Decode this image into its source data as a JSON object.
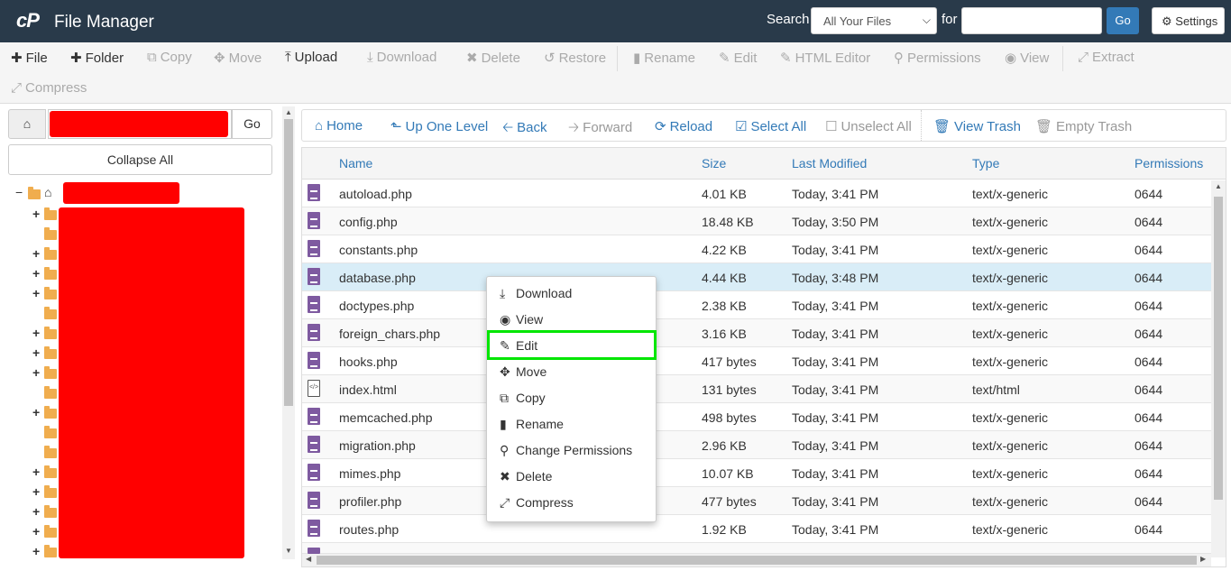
{
  "header": {
    "logo": "cP",
    "title": "File Manager",
    "search_label": "Search",
    "search_scope": "All Your Files",
    "for_label": "for",
    "search_value": "",
    "go_label": "Go",
    "settings_label": "Settings"
  },
  "toolbar": {
    "items": [
      {
        "label": "File",
        "icon": "plus-icon",
        "enabled": true
      },
      {
        "label": "Folder",
        "icon": "plus-icon",
        "enabled": true
      },
      {
        "label": "Copy",
        "icon": "copy-icon",
        "enabled": false
      },
      {
        "label": "Move",
        "icon": "move-icon",
        "enabled": false
      },
      {
        "label": "Upload",
        "icon": "upload-icon",
        "enabled": true
      },
      {
        "label": "Download",
        "icon": "download-icon",
        "enabled": false
      },
      {
        "label": "Delete",
        "icon": "delete-icon",
        "enabled": false
      },
      {
        "label": "Restore",
        "icon": "restore-icon",
        "enabled": false
      },
      {
        "label": "Rename",
        "icon": "file-icon",
        "enabled": false
      },
      {
        "label": "Edit",
        "icon": "pencil-icon",
        "enabled": false
      },
      {
        "label": "HTML Editor",
        "icon": "edit-square-icon",
        "enabled": false
      },
      {
        "label": "Permissions",
        "icon": "key-icon",
        "enabled": false
      },
      {
        "label": "View",
        "icon": "eye-icon",
        "enabled": false
      },
      {
        "label": "Extract",
        "icon": "extract-icon",
        "enabled": false
      },
      {
        "label": "Compress",
        "icon": "compress-icon",
        "enabled": false
      }
    ]
  },
  "left": {
    "go_label": "Go",
    "collapse_label": "Collapse All"
  },
  "nav": {
    "items": [
      {
        "label": "Home",
        "icon": "home-icon",
        "enabled": true
      },
      {
        "label": "Up One Level",
        "icon": "level-up-icon",
        "enabled": true
      },
      {
        "label": "Back",
        "icon": "arrow-left-icon",
        "enabled": true
      },
      {
        "label": "Forward",
        "icon": "arrow-right-icon",
        "enabled": false
      },
      {
        "label": "Reload",
        "icon": "reload-icon",
        "enabled": true
      },
      {
        "label": "Select All",
        "icon": "checkbox-checked-icon",
        "enabled": true
      },
      {
        "label": "Unselect All",
        "icon": "checkbox-empty-icon",
        "enabled": false
      },
      {
        "label": "View Trash",
        "icon": "trash-icon",
        "enabled": true
      },
      {
        "label": "Empty Trash",
        "icon": "trash-icon",
        "enabled": false
      }
    ]
  },
  "table": {
    "columns": [
      "Name",
      "Size",
      "Last Modified",
      "Type",
      "Permissions"
    ],
    "rows": [
      {
        "name": "autoload.php",
        "size": "4.01 KB",
        "modified": "Today, 3:41 PM",
        "type": "text/x-generic",
        "perms": "0644"
      },
      {
        "name": "config.php",
        "size": "18.48 KB",
        "modified": "Today, 3:50 PM",
        "type": "text/x-generic",
        "perms": "0644"
      },
      {
        "name": "constants.php",
        "size": "4.22 KB",
        "modified": "Today, 3:41 PM",
        "type": "text/x-generic",
        "perms": "0644"
      },
      {
        "name": "database.php",
        "size": "4.44 KB",
        "modified": "Today, 3:48 PM",
        "type": "text/x-generic",
        "perms": "0644"
      },
      {
        "name": "doctypes.php",
        "size": "2.38 KB",
        "modified": "Today, 3:41 PM",
        "type": "text/x-generic",
        "perms": "0644"
      },
      {
        "name": "foreign_chars.php",
        "size": "3.16 KB",
        "modified": "Today, 3:41 PM",
        "type": "text/x-generic",
        "perms": "0644"
      },
      {
        "name": "hooks.php",
        "size": "417 bytes",
        "modified": "Today, 3:41 PM",
        "type": "text/x-generic",
        "perms": "0644"
      },
      {
        "name": "index.html",
        "size": "131 bytes",
        "modified": "Today, 3:41 PM",
        "type": "text/html",
        "perms": "0644"
      },
      {
        "name": "memcached.php",
        "size": "498 bytes",
        "modified": "Today, 3:41 PM",
        "type": "text/x-generic",
        "perms": "0644"
      },
      {
        "name": "migration.php",
        "size": "2.96 KB",
        "modified": "Today, 3:41 PM",
        "type": "text/x-generic",
        "perms": "0644"
      },
      {
        "name": "mimes.php",
        "size": "10.07 KB",
        "modified": "Today, 3:41 PM",
        "type": "text/x-generic",
        "perms": "0644"
      },
      {
        "name": "profiler.php",
        "size": "477 bytes",
        "modified": "Today, 3:41 PM",
        "type": "text/x-generic",
        "perms": "0644"
      },
      {
        "name": "routes.php",
        "size": "1.92 KB",
        "modified": "Today, 3:41 PM",
        "type": "text/x-generic",
        "perms": "0644"
      }
    ]
  },
  "context_menu": {
    "items": [
      {
        "label": "Download",
        "icon": "download-icon"
      },
      {
        "label": "View",
        "icon": "eye-icon"
      },
      {
        "label": "Edit",
        "icon": "pencil-icon",
        "highlighted": true
      },
      {
        "label": "Move",
        "icon": "move-icon"
      },
      {
        "label": "Copy",
        "icon": "copy-icon"
      },
      {
        "label": "Rename",
        "icon": "file-icon"
      },
      {
        "label": "Change Permissions",
        "icon": "key-icon"
      },
      {
        "label": "Delete",
        "icon": "delete-icon"
      },
      {
        "label": "Compress",
        "icon": "compress-icon"
      }
    ]
  },
  "colors": {
    "header_bg": "#293a4a",
    "link": "#337ab7",
    "file_icon": "#7e5aa0",
    "folder": "#f0ad4e",
    "highlight": "#00e600",
    "redaction": "#ff0000"
  }
}
